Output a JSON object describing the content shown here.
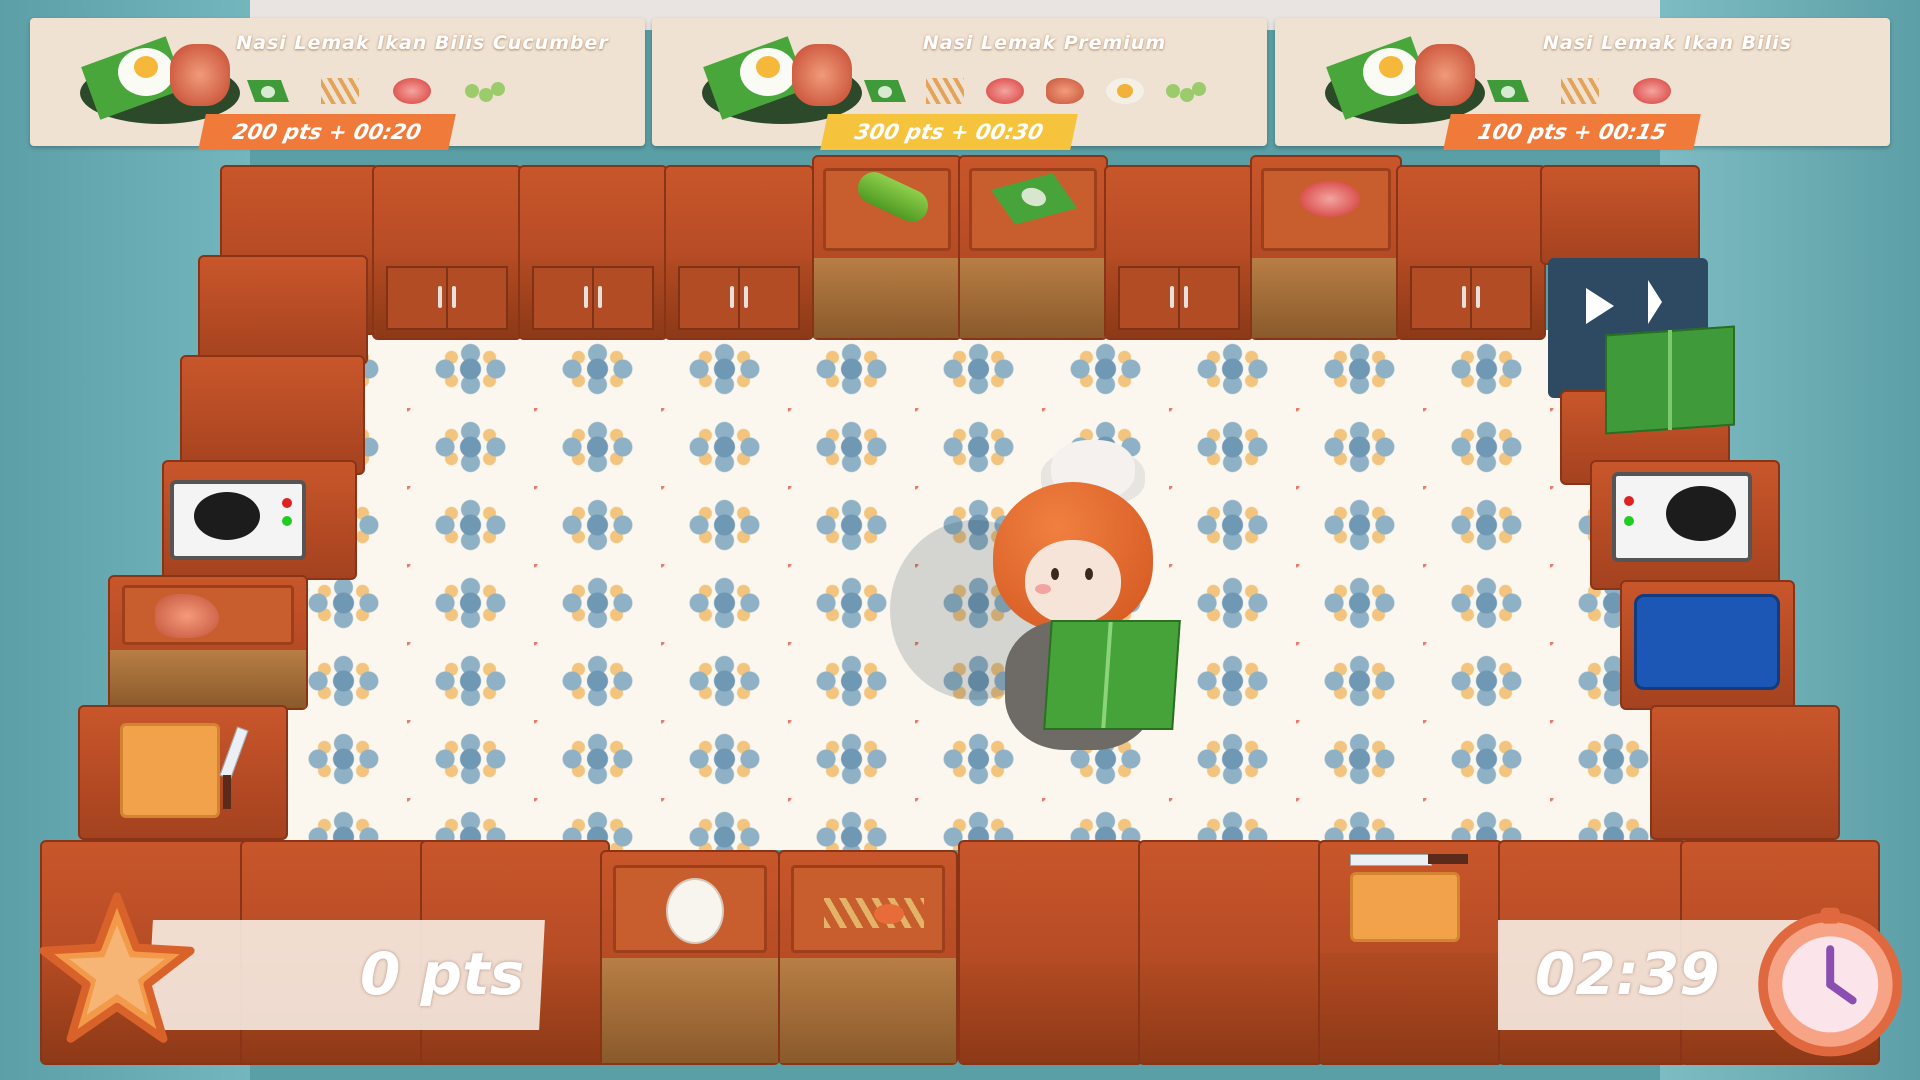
{
  "orders": [
    {
      "name": "Nasi Lemak Ikan Bilis Cucumber",
      "reward": "200 pts  +  00:20",
      "tag_color": "#f07a3a",
      "ingredients": [
        "banana-leaf-rice",
        "peanuts-anchovies",
        "sambal",
        "cucumber"
      ]
    },
    {
      "name": "Nasi Lemak Premium",
      "reward": "300 pts  +  00:30",
      "tag_color": "#f5c33c",
      "ingredients": [
        "banana-leaf-rice",
        "peanuts-anchovies",
        "sambal",
        "fried-chicken",
        "egg",
        "cucumber"
      ]
    },
    {
      "name": "Nasi Lemak Ikan Bilis",
      "reward": "100 pts  +  00:15",
      "tag_color": "#f07a3a",
      "ingredients": [
        "banana-leaf-rice",
        "peanuts-anchovies",
        "sambal"
      ]
    }
  ],
  "hud": {
    "score": "0 pts",
    "timer": "02:39"
  },
  "colors": {
    "counter": "#c0522a",
    "wall": "#5d9fa7",
    "hud_panel": "#f5e8de"
  }
}
